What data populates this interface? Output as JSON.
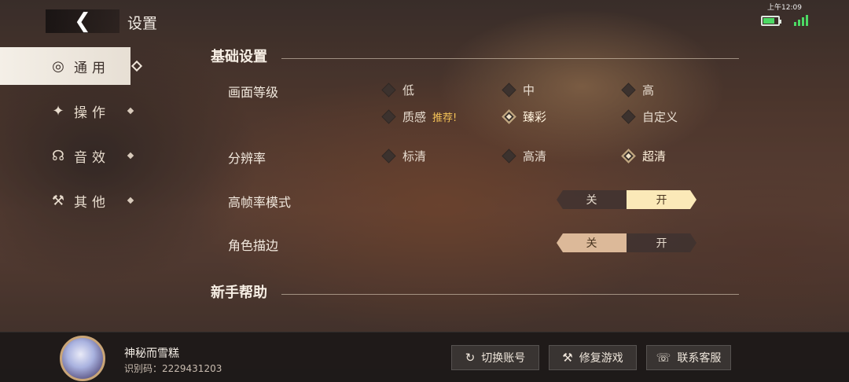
{
  "header": {
    "back_icon": "chevron-left-icon",
    "title": "设置"
  },
  "status_bar": {
    "time": "上午12:09",
    "battery_color": "#4cd964",
    "signal_color": "#4cd964"
  },
  "sidebar": {
    "items": [
      {
        "label": "通用",
        "icon": "broadcast-icon",
        "active": true
      },
      {
        "label": "操作",
        "icon": "joystick-icon",
        "active": false
      },
      {
        "label": "音效",
        "icon": "headset-icon",
        "active": false
      },
      {
        "label": "其他",
        "icon": "tools-icon",
        "active": false
      }
    ]
  },
  "sections": {
    "basic": {
      "title": "基础设置"
    },
    "help": {
      "title": "新手帮助"
    }
  },
  "graphics": {
    "label": "画面等级",
    "options": [
      "低",
      "中",
      "高",
      "质感",
      "臻彩",
      "自定义"
    ],
    "recommend_badge": "推荐!",
    "selected": "臻彩"
  },
  "resolution": {
    "label": "分辨率",
    "options": [
      "标清",
      "高清",
      "超清"
    ],
    "selected": "超清"
  },
  "high_fps": {
    "label": "高帧率模式",
    "off": "关",
    "on": "开",
    "value": "开"
  },
  "outline": {
    "label": "角色描边",
    "off": "关",
    "on": "开",
    "value": "关"
  },
  "user": {
    "name": "神秘而雪糕",
    "id_text": "识别码：2229431203"
  },
  "buttons": {
    "switch_account": "切换账号",
    "repair_game": "修复游戏",
    "support": "联系客服"
  },
  "accent_color": "#fbe9b8"
}
